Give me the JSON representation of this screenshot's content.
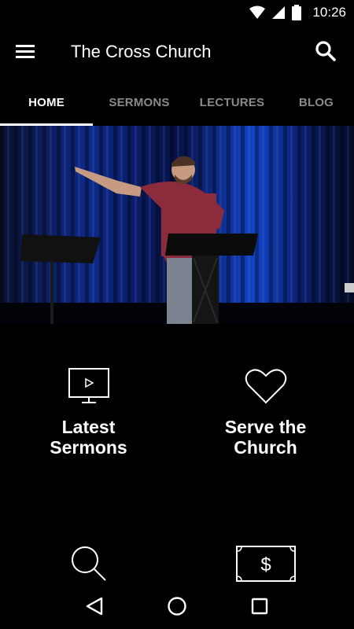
{
  "status_bar": {
    "time": "10:26",
    "icons": [
      "wifi-icon",
      "signal-icon",
      "battery-icon"
    ]
  },
  "app_bar": {
    "title": "The Cross Church",
    "menu_icon": "hamburger-menu-icon",
    "search_icon": "search-icon"
  },
  "tabs": [
    {
      "label": "HOME",
      "active": true
    },
    {
      "label": "SERMONS",
      "active": false
    },
    {
      "label": "LECTURES",
      "active": false
    },
    {
      "label": "BLOG",
      "active": false
    }
  ],
  "hero": {
    "description_icon": "hero-image"
  },
  "tiles": [
    {
      "label": "Latest\nSermons",
      "icon": "video-monitor-icon"
    },
    {
      "label": "Serve the\nChurch",
      "icon": "heart-icon"
    },
    {
      "label": "",
      "icon": "search-icon"
    },
    {
      "label": "",
      "icon": "dollar-bill-icon"
    }
  ],
  "nav_bar": {
    "icons": [
      "back-icon",
      "home-icon",
      "recents-icon"
    ]
  },
  "colors": {
    "background": "#000000",
    "text": "#ffffff",
    "tab_inactive": "#8a8a8a",
    "accent": "#ffffff"
  }
}
